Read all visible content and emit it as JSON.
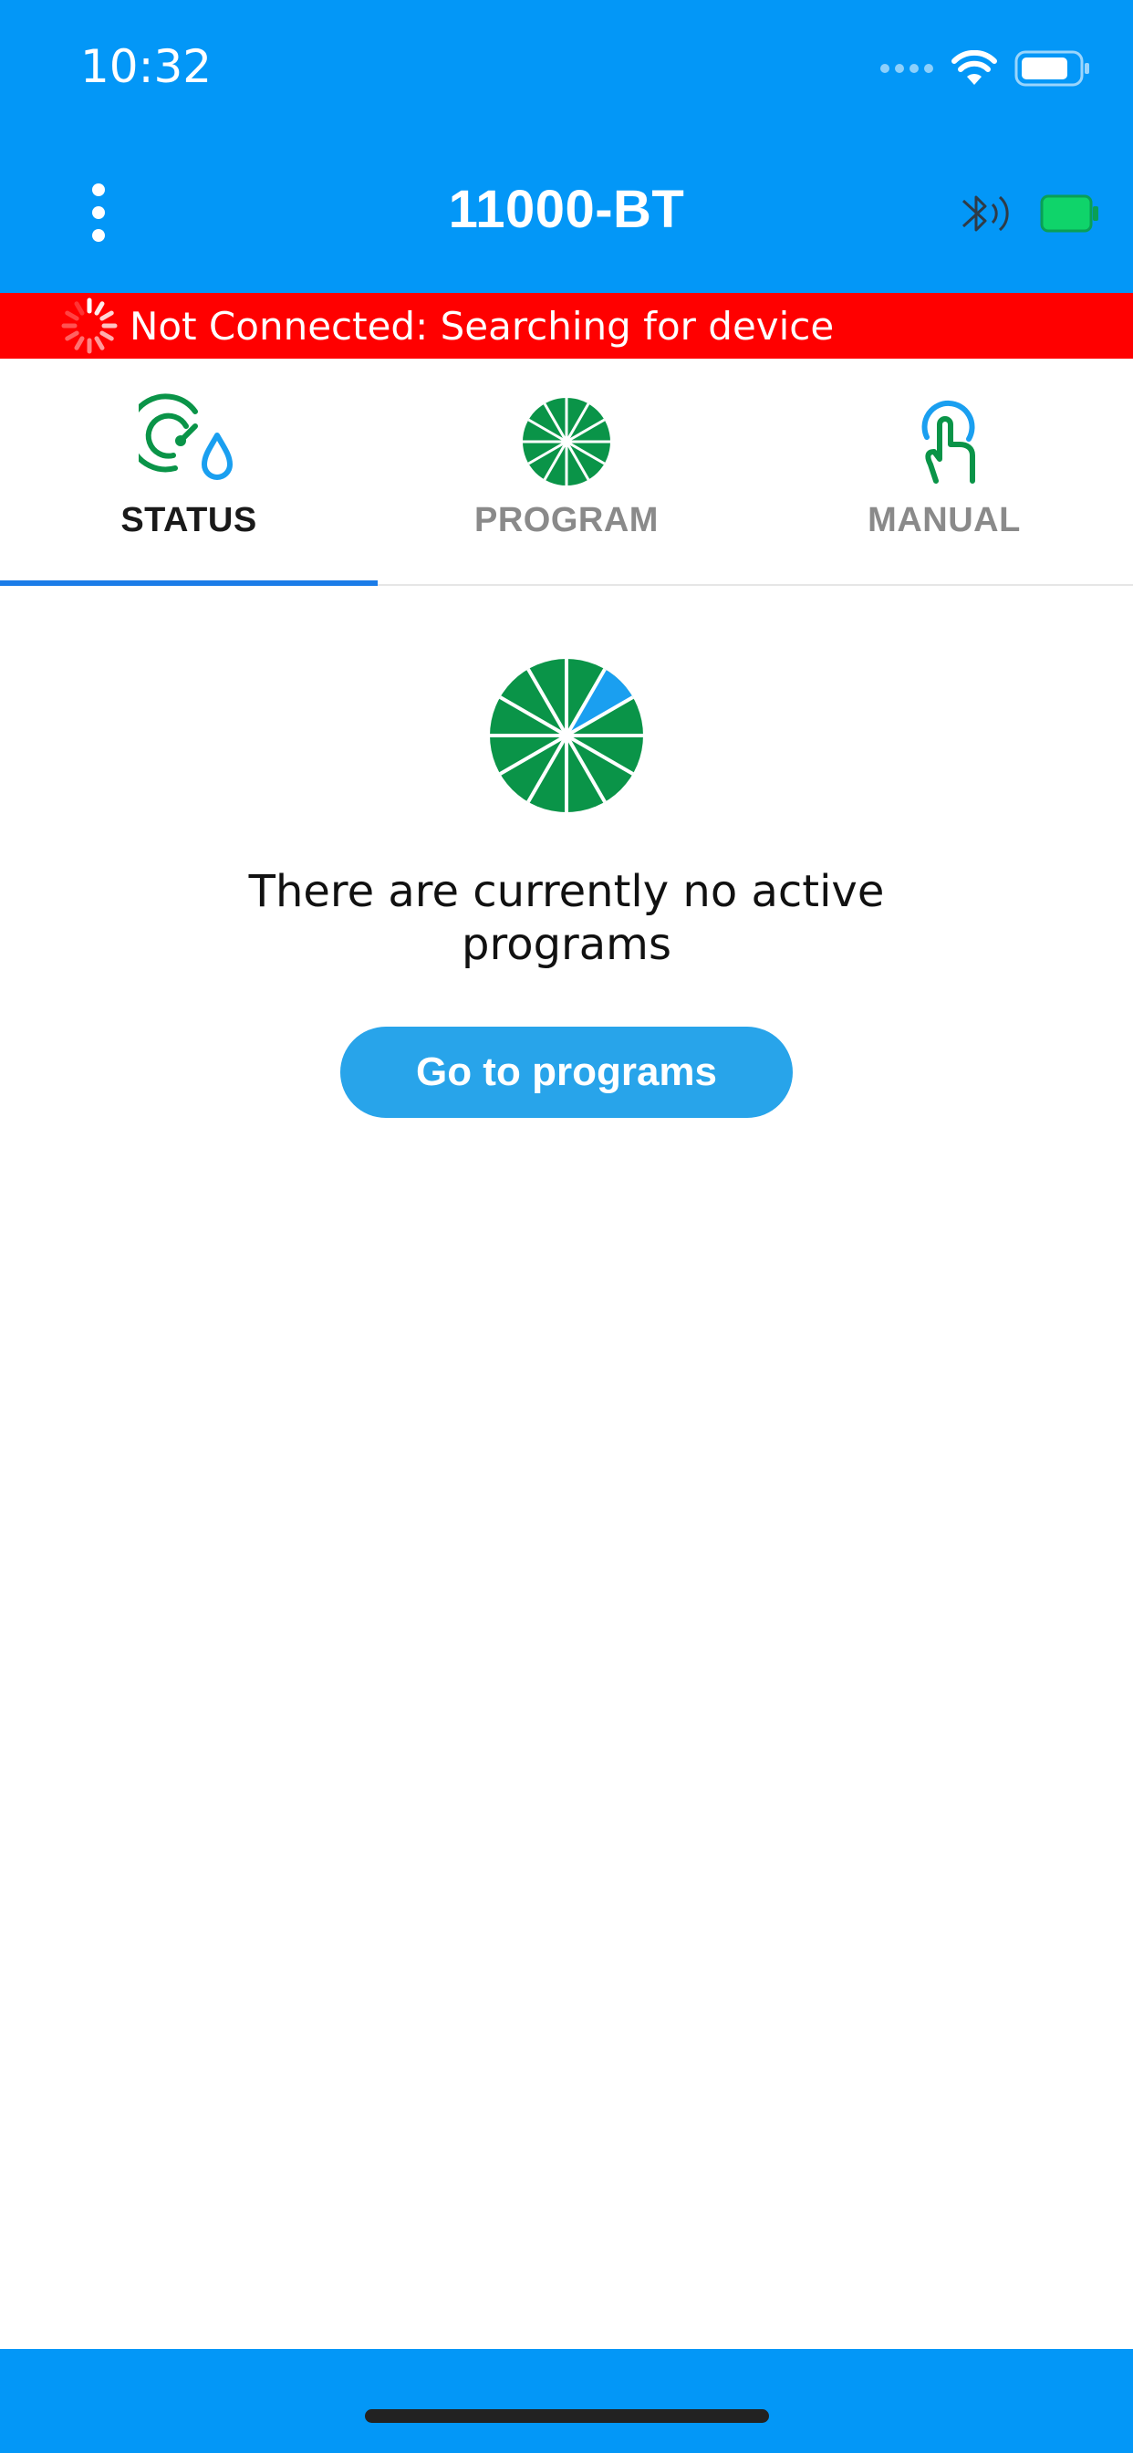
{
  "status_bar": {
    "time": "10:32",
    "icons": [
      "signal-dots-icon",
      "wifi-icon",
      "battery-icon"
    ]
  },
  "nav": {
    "title": "11000-BT",
    "menu_icon": "kebab-menu-icon",
    "right_icons": [
      "bluetooth-searching-icon",
      "device-battery-icon"
    ]
  },
  "connection": {
    "text": "Not Connected: Searching for device",
    "color": "#ff0000"
  },
  "tabs": [
    {
      "label": "STATUS",
      "icon": "gauge-drop-icon",
      "active": true
    },
    {
      "label": "PROGRAM",
      "icon": "program-wheel-icon",
      "active": false
    },
    {
      "label": "MANUAL",
      "icon": "touch-hand-icon",
      "active": false
    }
  ],
  "main": {
    "empty_message": "There are currently no active programs",
    "button_label": "Go to programs"
  },
  "colors": {
    "header_blue": "#0397f7",
    "accent_green": "#0a9448",
    "accent_blue": "#1a9ff0",
    "button_blue": "#28a4ea",
    "tab_underline": "#1b7ce8"
  }
}
